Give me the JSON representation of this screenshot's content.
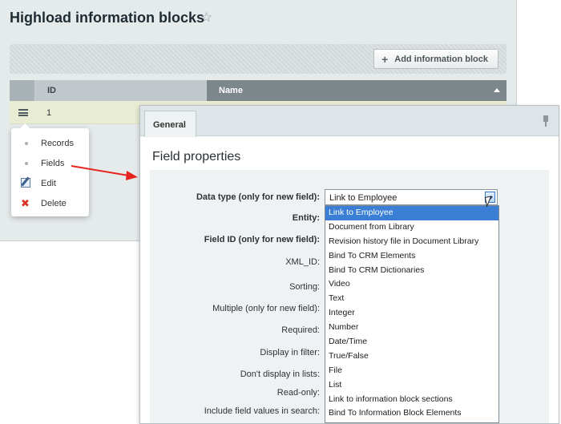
{
  "page": {
    "title": "Highload information blocks",
    "add_button_label": "Add information block"
  },
  "grid": {
    "columns": [
      "ID",
      "Name"
    ],
    "rows": [
      {
        "id": "1"
      }
    ]
  },
  "context_menu": {
    "items": [
      "Records",
      "Fields",
      "Edit",
      "Delete"
    ]
  },
  "dialog": {
    "tab_label": "General",
    "section_title": "Field properties",
    "field_labels": [
      "Data type (only for new field):",
      "Entity:",
      "Field ID (only for new field):",
      "XML_ID:",
      "Sorting:",
      "Multiple (only for new field):",
      "Required:",
      "Display in filter:",
      "Don't display in lists:",
      "Read-only:",
      "Include field values in search:"
    ],
    "data_type": {
      "selected": "Link to Employee",
      "options": [
        "Link to Employee",
        "Document from Library",
        "Revision history file in Document Library",
        "Bind To CRM Elements",
        "Bind To CRM Dictionaries",
        "Video",
        "Text",
        "Integer",
        "Number",
        "Date/Time",
        "True/False",
        "File",
        "List",
        "Link to information block sections",
        "Bind To Information Block Elements"
      ]
    }
  },
  "colors": {
    "arrow": "#e8241f",
    "selected_option": "#3a7fd5",
    "row_highlight": "#e8ecd3"
  }
}
